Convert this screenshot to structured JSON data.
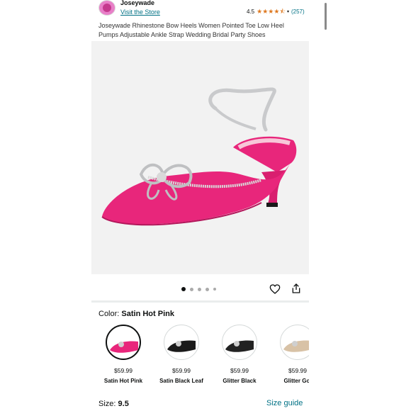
{
  "store": {
    "name": "Joseywade",
    "visit_link": "Visit the Store",
    "logo_icon": "store-logo-icon"
  },
  "rating": {
    "value": "4.5",
    "stars": 4.5,
    "count": "(257)"
  },
  "product": {
    "title": "Joseywade Rhinestone Bow Heels Women Pointed Toe Low Heel Pumps Adjustable Ankle Strap Wedding Bridal Party Shoes",
    "image_icon": "pink-heel-shoe-image"
  },
  "gallery": {
    "dot_count": 5,
    "active_index": 0,
    "heart_icon": "heart-icon",
    "share_icon": "share-icon"
  },
  "color": {
    "label": "Color:",
    "selected": "Satin Hot Pink",
    "options": [
      {
        "price": "$59.99",
        "name": "Satin Hot Pink",
        "swatch": "#e8267b"
      },
      {
        "price": "$59.99",
        "name": "Satin Black Leaf",
        "swatch": "#1a1a1a"
      },
      {
        "price": "$59.99",
        "name": "Glitter Black",
        "swatch": "#222222"
      },
      {
        "price": "$59.99",
        "name": "Glitter Gol",
        "swatch": "#d8c2a6"
      }
    ]
  },
  "size": {
    "label": "Size:",
    "selected": "9.5",
    "guide_link": "Size guide"
  },
  "colors": {
    "link": "#007185",
    "star": "#de7921",
    "accent_pink": "#e8267b"
  }
}
